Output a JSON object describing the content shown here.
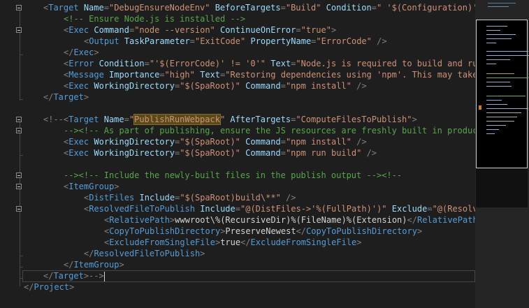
{
  "colors": {
    "background": "#1e1e1e",
    "delimiter": "#808080",
    "tag": "#569cd6",
    "attribute": "#9cdcfe",
    "string": "#ce9178",
    "text": "#d4d4d4",
    "comment": "#57a64a",
    "highlight": "#5a4a1a"
  },
  "code": {
    "l1": {
      "target_open": "<",
      "target_tag": "Target",
      "a_name": "Name",
      "v_name": "\"DebugEnsureNodeEnv\"",
      "a_before": "BeforeTargets",
      "v_before": "\"Build\"",
      "a_condition": "Condition",
      "v_condition": "\" '$(Configuration)' =="
    },
    "l2": {
      "comment": "<!-- Ensure Node.js is installed -->"
    },
    "l3": {
      "tag": "Exec",
      "a_command": "Command",
      "v_command": "\"node --version\"",
      "a_continue": "ContinueOnError",
      "v_continue": "\"true\""
    },
    "l4": {
      "tag": "Output",
      "a_taskparam": "TaskParameter",
      "v_taskparam": "\"ExitCode\"",
      "a_propname": "PropertyName",
      "v_propname": "\"ErrorCode\""
    },
    "l5": {
      "close_tag": "Exec"
    },
    "l6": {
      "tag": "Error",
      "a_condition": "Condition",
      "v_condition": "\"'$(ErrorCode)' != '0'\"",
      "a_text": "Text",
      "v_text": "\"Node.js is required to build and run t"
    },
    "l7": {
      "tag": "Message",
      "a_importance": "Importance",
      "v_importance": "\"high\"",
      "a_text": "Text",
      "v_text": "\"Restoring dependencies using 'npm'. This may take se"
    },
    "l8": {
      "tag": "Exec",
      "a_workdir": "WorkingDirectory",
      "v_workdir": "\"$(SpaRoot)\"",
      "a_command": "Command",
      "v_command": "\"npm install\""
    },
    "l9": {
      "close_tag": "Target"
    },
    "l11": {
      "comment_open": "<!--",
      "tag": "Target",
      "a_name": "Name",
      "v_name_highlight": "PublishRunWebpack",
      "a_after": "AfterTargets",
      "v_after": "\"ComputeFilesToPublish\""
    },
    "l12": {
      "comment": "--><!-- As part of publishing, ensure the JS resources are freshly built in productio"
    },
    "l13": {
      "tag": "Exec",
      "a_workdir": "WorkingDirectory",
      "v_workdir": "\"$(SpaRoot)\"",
      "a_command": "Command",
      "v_command": "\"npm install\""
    },
    "l14": {
      "tag": "Exec",
      "a_workdir": "WorkingDirectory",
      "v_workdir": "\"$(SpaRoot)\"",
      "a_command": "Command",
      "v_command": "\"npm run build\""
    },
    "l16": {
      "comment": "--><!-- Include the newly-built files in the publish output --><!--"
    },
    "l17": {
      "tag": "ItemGroup"
    },
    "l18": {
      "tag": "DistFiles",
      "a_include": "Include",
      "v_include": "\"$(SpaRoot)build\\**\""
    },
    "l19": {
      "tag": "ResolvedFileToPublish",
      "a_include": "Include",
      "v_include": "\"@(DistFiles->'%(FullPath)')\"",
      "a_exclude": "Exclude",
      "v_exclude": "\"@(Resolved"
    },
    "l20": {
      "tag": "RelativePath",
      "value": "wwwroot\\%(RecursiveDir)%(FileName)%(Extension)"
    },
    "l21": {
      "tag": "CopyToPublishDirectory",
      "value": "PreserveNewest"
    },
    "l22": {
      "tag": "ExcludeFromSingleFile",
      "value": "true"
    },
    "l23": {
      "close_tag": "ResolvedFileToPublish"
    },
    "l24": {
      "close_tag": "ItemGroup"
    },
    "l25": {
      "close_tag": "Target",
      "comment_close": "-->"
    },
    "l26": {
      "close_tag": "Project"
    }
  }
}
